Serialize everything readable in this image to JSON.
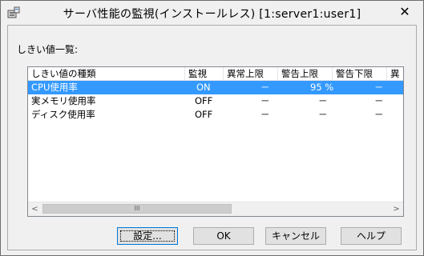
{
  "window": {
    "title": "サーバ性能の監視(インストールレス) [1:server1:user1]",
    "close_glyph": "✕",
    "app_icon": "server-monitor-icon"
  },
  "group": {
    "label": "しきい値一覧:"
  },
  "table": {
    "columns": [
      "しきい値の種類",
      "監視",
      "異常上限",
      "警告上限",
      "警告下限",
      "異"
    ],
    "rows": [
      {
        "type": "CPU使用率",
        "monitor": "ON",
        "error_upper": "－",
        "warn_upper": "95 %",
        "warn_lower": "－",
        "selected": true
      },
      {
        "type": "実メモリ使用率",
        "monitor": "OFF",
        "error_upper": "－",
        "warn_upper": "－",
        "warn_lower": "－",
        "selected": false
      },
      {
        "type": "ディスク使用率",
        "monitor": "OFF",
        "error_upper": "－",
        "warn_upper": "－",
        "warn_lower": "－",
        "selected": false
      }
    ],
    "scrollbar": {
      "left_arrow": "<",
      "right_arrow": ">",
      "thumb_grip": "III"
    }
  },
  "buttons": {
    "settings": "設定...",
    "ok": "OK",
    "cancel": "キャンセル",
    "help": "ヘルプ"
  },
  "colors": {
    "selection": "#3399ff",
    "window_bg": "#f0f0f0"
  }
}
